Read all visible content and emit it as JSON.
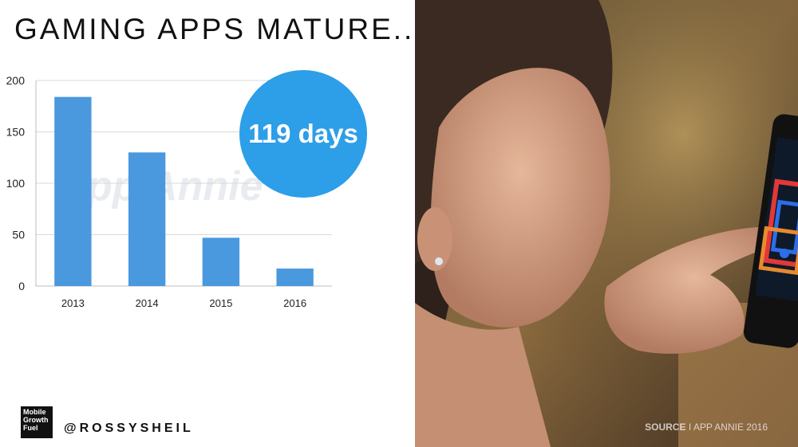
{
  "slide": {
    "title": "GAMING APPS MATURE..",
    "badge_text": "119 days",
    "watermark": "App Annie",
    "handle": "@ROSSYSHEIL",
    "logo_lines": [
      "Mobile",
      "Growth",
      "Fuel"
    ],
    "source_label": "SOURCE",
    "source_separator": "I",
    "source_text": "APP ANNIE 2016"
  },
  "colors": {
    "bar": "#4a98de",
    "badge": "#2d9ee8",
    "grid": "#d9d9d9"
  },
  "chart_data": {
    "type": "bar",
    "categories": [
      "2013",
      "2014",
      "2015",
      "2016"
    ],
    "values": [
      184,
      130,
      47,
      17
    ],
    "title": "",
    "xlabel": "",
    "ylabel": "",
    "ylim": [
      0,
      200
    ],
    "yticks": [
      0,
      50,
      100,
      150,
      200
    ],
    "grid": true
  }
}
